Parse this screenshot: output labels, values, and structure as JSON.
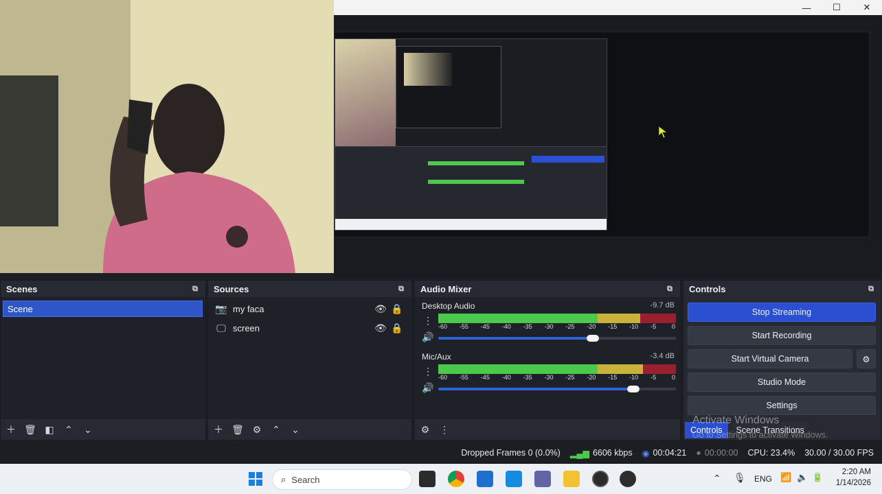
{
  "window": {
    "minimize_glyph": "—",
    "maximize_glyph": "☐",
    "close_glyph": "✕"
  },
  "scenes": {
    "title": "Scenes",
    "items": [
      {
        "label": "Scene",
        "selected": true
      }
    ]
  },
  "sources": {
    "title": "Sources",
    "items": [
      {
        "label": "my faca",
        "icon": "camera-icon"
      },
      {
        "label": "screen",
        "icon": "monitor-icon"
      }
    ]
  },
  "mixer": {
    "title": "Audio Mixer",
    "channels": [
      {
        "name": "Desktop Audio",
        "db": "-9.7 dB",
        "level_fraction": 0.85,
        "volume_fraction": 0.65
      },
      {
        "name": "Mic/Aux",
        "db": "-3.4 dB",
        "level_fraction": 0.86,
        "volume_fraction": 0.82
      }
    ],
    "tick_labels": [
      "-60",
      "-55",
      "-45",
      "-40",
      "-35",
      "-30",
      "-25",
      "-20",
      "-15",
      "-10",
      "-5",
      "0"
    ]
  },
  "controls": {
    "title": "Controls",
    "buttons": {
      "stop_streaming": "Stop Streaming",
      "start_recording": "Start Recording",
      "start_virtual_camera": "Start Virtual Camera",
      "studio_mode": "Studio Mode",
      "settings": "Settings"
    },
    "tabs": {
      "controls": "Controls",
      "scene_transitions": "Scene Transitions"
    }
  },
  "watermark": {
    "line1": "Activate Windows",
    "line2": "Go to Settings to activate Windows."
  },
  "status": {
    "dropped_frames": "Dropped Frames 0 (0.0%)",
    "bitrate": "6606 kbps",
    "stream_time": "00:04:21",
    "record_time": "00:00:00",
    "cpu": "CPU: 23.4%",
    "fps": "30.00 / 30.00 FPS"
  },
  "taskbar": {
    "search_placeholder": "Search",
    "lang": "ENG",
    "time": "2:20 AM",
    "date": "1/14/2026"
  },
  "colors": {
    "accent": "#2b4fd1",
    "meter_green": "#4cc94c",
    "meter_yellow": "#c9b23a",
    "meter_red": "#9a2030"
  }
}
